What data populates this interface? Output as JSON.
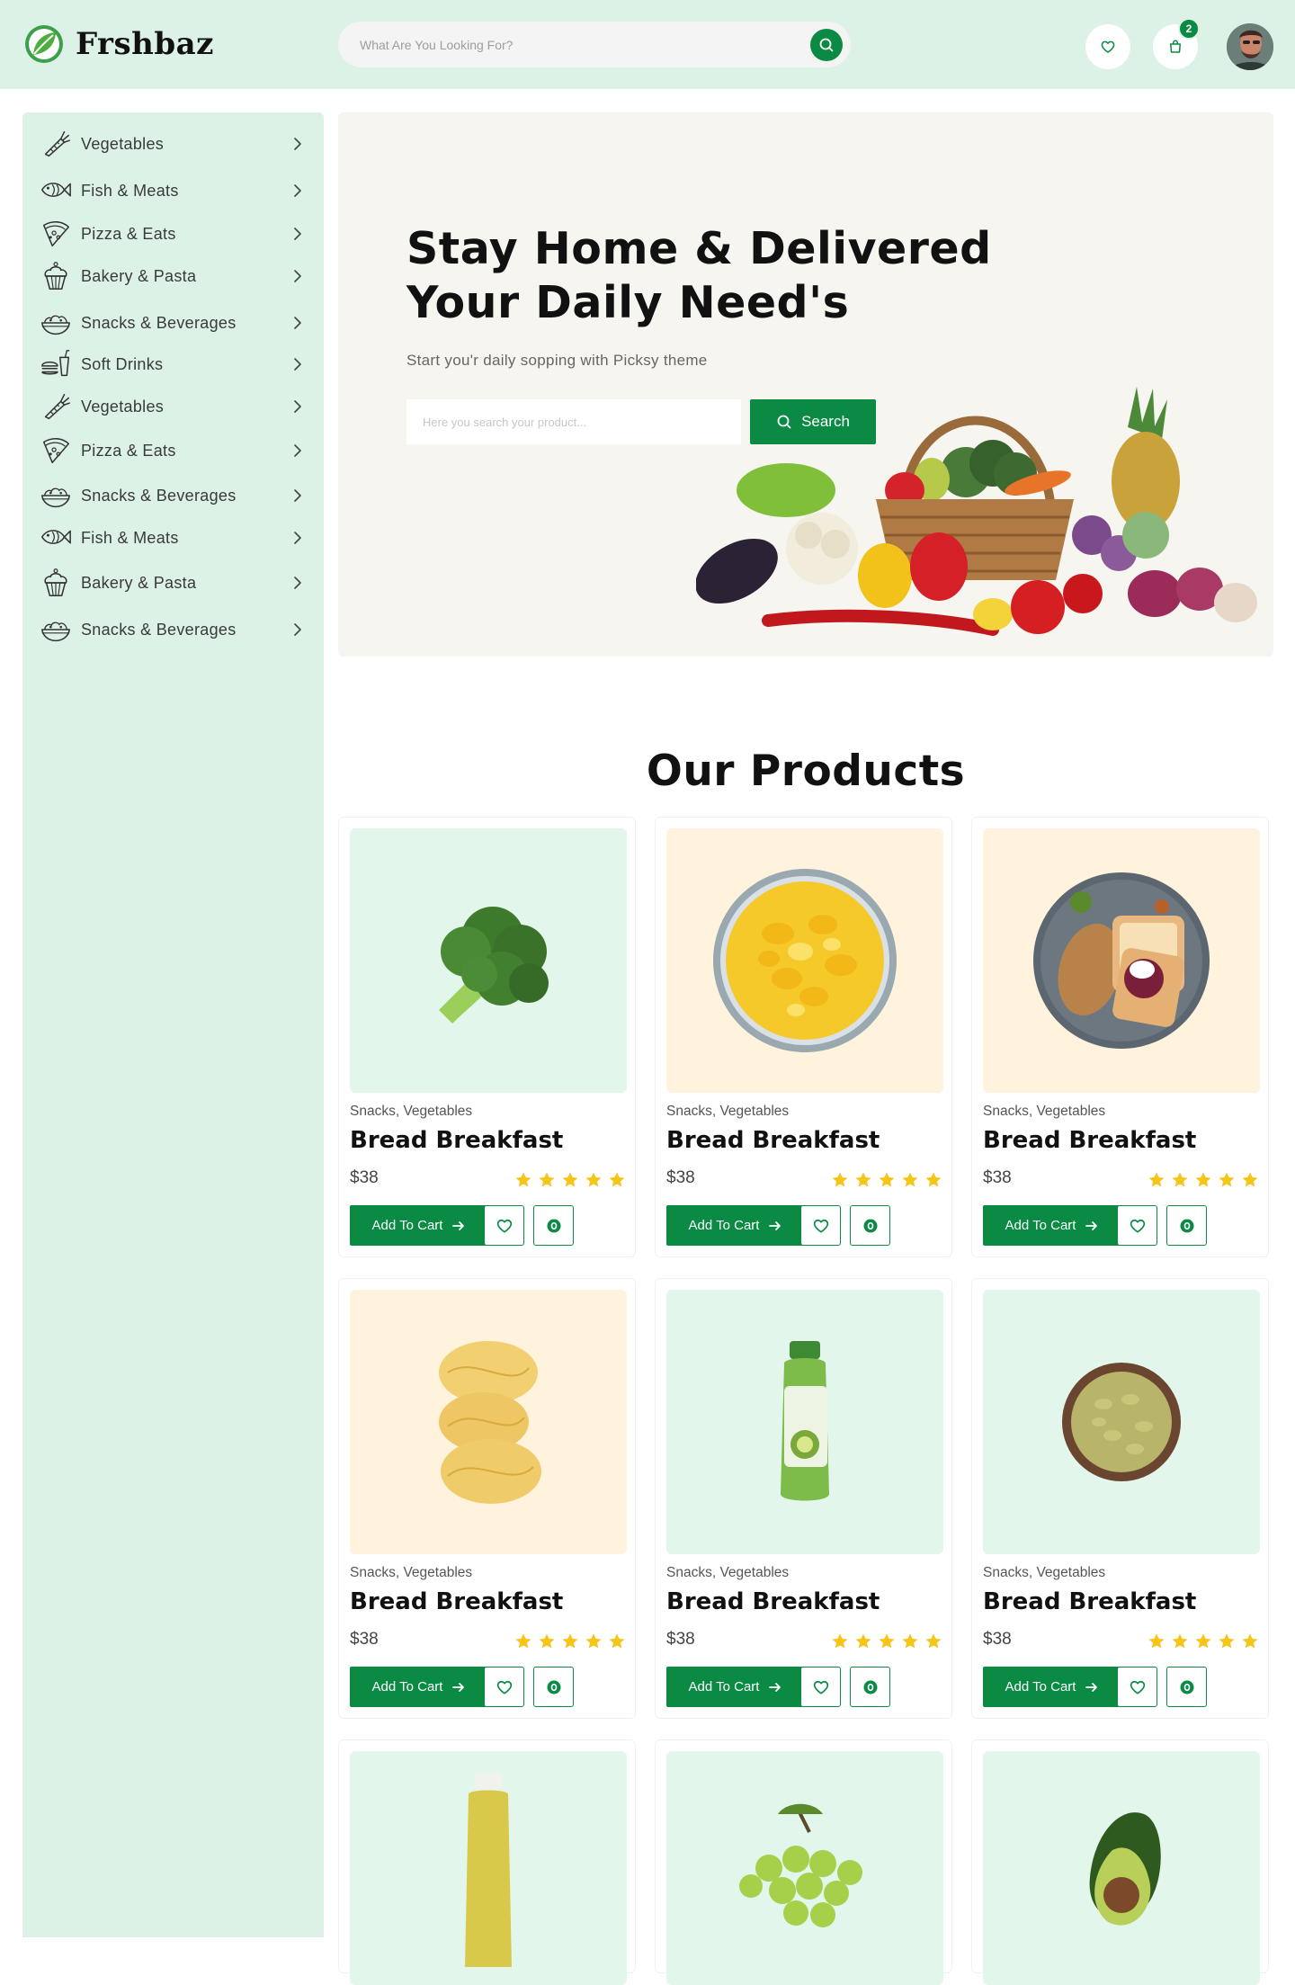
{
  "header": {
    "brand": "Frshbaz",
    "search_placeholder": "What Are You Looking For?",
    "cart_count": "2"
  },
  "sidebar": {
    "items": [
      {
        "label": "Vegetables",
        "icon": "carrot-icon"
      },
      {
        "label": "Fish & Meats",
        "icon": "fish-icon"
      },
      {
        "label": "Pizza & Eats",
        "icon": "pizza-icon"
      },
      {
        "label": "Bakery & Pasta",
        "icon": "cupcake-icon"
      },
      {
        "label": "Snacks & Beverages",
        "icon": "salad-bowl-icon"
      },
      {
        "label": "Soft Drinks",
        "icon": "burger-drink-icon"
      },
      {
        "label": "Vegetables",
        "icon": "carrot-icon"
      },
      {
        "label": "Pizza & Eats",
        "icon": "pizza-icon"
      },
      {
        "label": "Snacks & Beverages",
        "icon": "salad-bowl-icon"
      },
      {
        "label": "Fish & Meats",
        "icon": "fish-icon"
      },
      {
        "label": "Bakery & Pasta",
        "icon": "cupcake-icon"
      },
      {
        "label": "Snacks & Beverages",
        "icon": "salad-bowl-icon"
      }
    ]
  },
  "hero": {
    "title_line1": "Stay Home & Delivered",
    "title_line2": "Your Daily Need's",
    "subtitle": "Start you'r daily sopping with Picksy theme",
    "search_placeholder": "Here you search your product...",
    "search_label": "Search"
  },
  "products": {
    "title": "Our Products",
    "items": [
      {
        "category": "Snacks, Vegetables",
        "name": "Bread Breakfast",
        "price": "$38",
        "rating": 5,
        "image": "broccoli",
        "bg": "#e3f6ec",
        "add_label": "Add To Cart"
      },
      {
        "category": "Snacks, Vegetables",
        "name": "Bread Breakfast",
        "price": "$38",
        "rating": 5,
        "image": "cornflakes-bowl",
        "bg": "#fff3dd",
        "add_label": "Add To Cart"
      },
      {
        "category": "Snacks, Vegetables",
        "name": "Bread Breakfast",
        "price": "$38",
        "rating": 5,
        "image": "breakfast-plate",
        "bg": "#fff3dd",
        "add_label": "Add To Cart"
      },
      {
        "category": "Snacks, Vegetables",
        "name": "Bread Breakfast",
        "price": "$38",
        "rating": 5,
        "image": "pasta-nest",
        "bg": "#fff3dd",
        "add_label": "Add To Cart"
      },
      {
        "category": "Snacks, Vegetables",
        "name": "Bread Breakfast",
        "price": "$38",
        "rating": 5,
        "image": "juice-bottle",
        "bg": "#e3f6ec",
        "add_label": "Add To Cart"
      },
      {
        "category": "Snacks, Vegetables",
        "name": "Bread Breakfast",
        "price": "$38",
        "rating": 5,
        "image": "cardamom-bowl",
        "bg": "#e3f6ec",
        "add_label": "Add To Cart"
      },
      {
        "image": "pressed-juice",
        "bg": "#e3f6ec"
      },
      {
        "image": "green-grapes",
        "bg": "#e3f6ec"
      },
      {
        "image": "avocado",
        "bg": "#e3f6ec"
      }
    ]
  },
  "colors": {
    "accent": "#0a8a43",
    "header_bg": "#dcf2e6",
    "sidebar_bg": "#dcf2e6",
    "hero_bg": "#f6f5ef",
    "star": "#f5c518"
  }
}
